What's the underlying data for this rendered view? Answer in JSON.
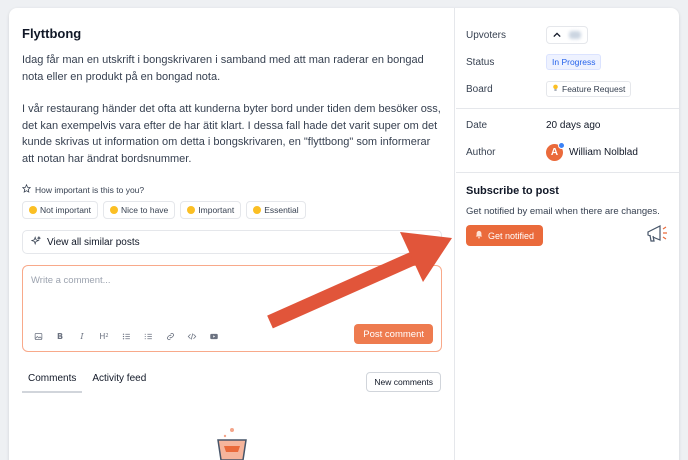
{
  "post": {
    "title": "Flyttbong",
    "paragraphs": [
      "Idag får man en utskrift i bongskrivaren i samband med att man raderar en bongad nota eller en produkt på en bongad nota.",
      "I vår restaurang händer det ofta att kunderna byter bord under tiden dem besöker oss, det kan exempelvis vara efter de har ätit klart. I dessa fall hade det varit super om det kunde skrivas ut information om detta i bongskrivaren, en \"flyttbong\" som informerar att notan har ändrat bordsnummer."
    ]
  },
  "importance": {
    "question": "How important is this to you?",
    "options": [
      "Not important",
      "Nice to have",
      "Important",
      "Essential"
    ]
  },
  "similar": {
    "label": "View all similar posts"
  },
  "comment": {
    "placeholder": "Write a comment...",
    "post_label": "Post comment",
    "toolbar": [
      "image",
      "bold",
      "italic",
      "heading-2",
      "bullet-list",
      "numbered-list",
      "link",
      "code",
      "video"
    ]
  },
  "tabs": {
    "comments": "Comments",
    "activity": "Activity feed",
    "new_comments": "New comments"
  },
  "sidebar": {
    "upvoters_label": "Upvoters",
    "status_label": "Status",
    "status_value": "In Progress",
    "board_label": "Board",
    "board_value": "Feature Request",
    "date_label": "Date",
    "date_value": "20 days ago",
    "author_label": "Author",
    "author_name": "William Nolblad",
    "author_initial": "A",
    "subscribe_title": "Subscribe to post",
    "subscribe_desc": "Get notified by email when there are changes.",
    "notify_label": "Get notified"
  },
  "colors": {
    "accent": "#ea6a3b",
    "status_blue": "#2563eb",
    "annotation_arrow": "#e1553a"
  }
}
